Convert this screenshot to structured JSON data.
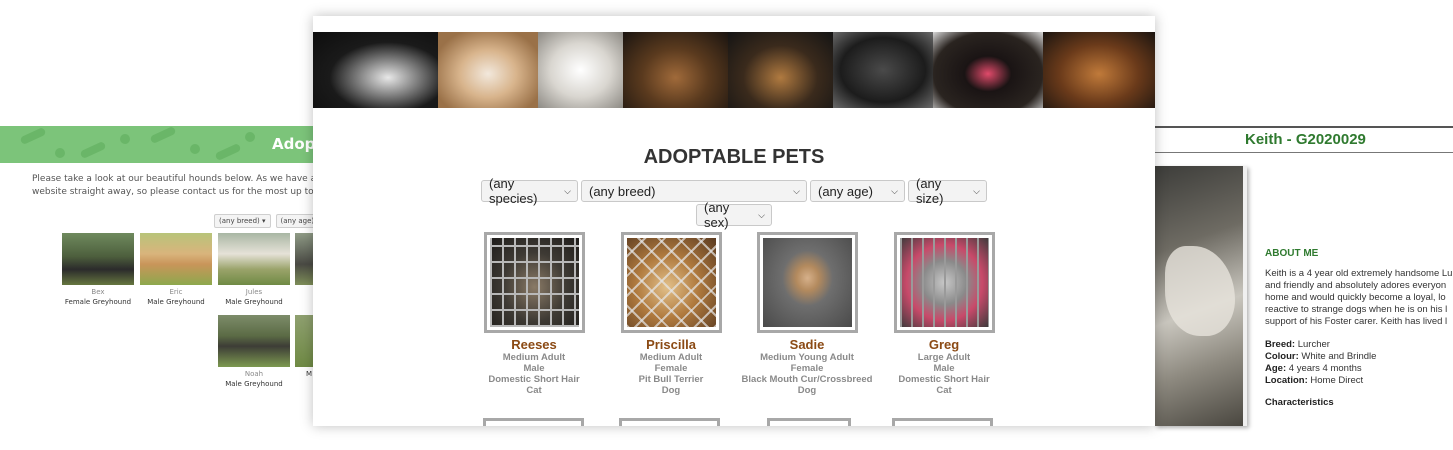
{
  "left_page": {
    "banner_title": "Adopt",
    "intro_lines": [
      "Please take a look at our beautiful hounds below. As we have a consta",
      "website straight away, so please contact us for the most up to date inf"
    ],
    "filters": [
      "(any breed) ▾",
      "(any age) ▾"
    ],
    "hounds": [
      {
        "name": "Bex",
        "desc": "Female Greyhound"
      },
      {
        "name": "Eric",
        "desc": "Male Greyhound"
      },
      {
        "name": "Jules",
        "desc": "Male Greyhound"
      },
      {
        "name": "Noah",
        "desc": "Male Greyhound"
      },
      {
        "name": "",
        "desc": "M"
      }
    ]
  },
  "right_page": {
    "title": "Keith - G2020029",
    "about_heading": "ABOUT ME",
    "about_lines": [
      "Keith is a 4 year old extremely handsome Lu",
      "and friendly and absolutely adores everyon",
      "home and would quickly become a loyal, lo",
      "reactive to strange dogs when he is on his l",
      "support of his Foster carer. Keith has lived l"
    ],
    "facts": [
      {
        "label": "Breed:",
        "value": "Lurcher"
      },
      {
        "label": "Colour:",
        "value": "White and Brindle"
      },
      {
        "label": "Age:",
        "value": "4 years 4 months"
      },
      {
        "label": "Location:",
        "value": "Home Direct"
      }
    ],
    "characteristics_heading": "Characteristics"
  },
  "center_page": {
    "title": "ADOPTABLE PETS",
    "filters": {
      "species": "(any species)",
      "breed": "(any breed)",
      "age": "(any age)",
      "size": "(any size)",
      "sex": "(any sex)"
    },
    "pets": [
      {
        "name": "Reeses",
        "size_age": "Medium Adult",
        "sex": "Male",
        "breed": "Domestic Short Hair",
        "species": "Cat"
      },
      {
        "name": "Priscilla",
        "size_age": "Medium Adult",
        "sex": "Female",
        "breed": "Pit Bull Terrier",
        "species": "Dog"
      },
      {
        "name": "Sadie",
        "size_age": "Medium Young Adult",
        "sex": "Female",
        "breed": "Black Mouth Cur/Crossbreed",
        "species": "Dog"
      },
      {
        "name": "Greg",
        "size_age": "Large Adult",
        "sex": "Male",
        "breed": "Domestic Short Hair",
        "species": "Cat"
      }
    ]
  },
  "colors": {
    "left_banner": "#7cc47a",
    "right_title": "#2f7a2f",
    "pet_name": "#8b4a14",
    "pet_detail": "#8a8a8a"
  }
}
